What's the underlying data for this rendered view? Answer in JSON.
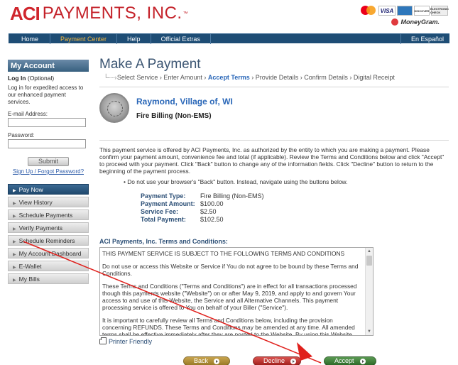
{
  "header": {
    "brand_aci": "ACI",
    "brand_rest": "PAYMENTS, INC.",
    "brand_tm": "™",
    "cards": {
      "visa": "VISA",
      "amex": "",
      "discover": "DISCOVER",
      "electronic": "ELECTRONIC CHECK"
    },
    "moneygram": "MoneyGram."
  },
  "nav": {
    "items": [
      "Home",
      "Payment Center",
      "Help",
      "Official Extras"
    ],
    "active": "Payment Center",
    "language": "En Español"
  },
  "sidebar": {
    "title": "My Account",
    "login_bold": "Log In",
    "login_optional": " (Optional)",
    "login_desc": "Log in for expedited access to our enhanced payment services.",
    "email_label": "E-mail Address:",
    "password_label": "Password:",
    "submit": "Submit",
    "signup": "Sign Up / Forgot Password?",
    "menu": [
      "Pay Now",
      "View History",
      "Schedule Payments",
      "Verify Payments",
      "Schedule Reminders",
      "My Account Dashboard",
      "E-Wallet",
      "My Bills"
    ]
  },
  "main": {
    "title": "Make A Payment",
    "steps_prefix": "Select Service › Enter Amount › ",
    "steps_current": "Accept Terms",
    "steps_suffix": " › Provide Details › Confirm Details › Digital Receipt",
    "biller_name": "Raymond, Village of, WI",
    "biller_service": "Fire Billing (Non-EMS)",
    "intro": "This payment service is offered by ACI Payments, Inc. as authorized by the entity to which you are making a payment. Please confirm your payment amount, convenience fee and total (if applicable). Review the Terms and Conditions below and click \"Accept\" to proceed with your payment. Click \"Back\" button to change any of the information fields. Click \"Decline\" button to return to the beginning of the payment process.",
    "bullet": "• Do not use your browser's \"Back\" button. Instead, navigate using the buttons below.",
    "payment": {
      "type_label": "Payment Type:",
      "type_value": "Fire Billing (Non-EMS)",
      "amount_label": "Payment Amount:",
      "amount_value": "$100.00",
      "fee_label": "Service Fee:",
      "fee_value": "$2.50",
      "total_label": "Total Payment:",
      "total_value": "$102.50"
    },
    "terms_title": "ACI Payments, Inc. Terms and Conditions:",
    "terms": [
      "THIS PAYMENT SERVICE IS SUBJECT TO THE FOLLOWING TERMS AND CONDITIONS",
      "Do not use or access this Website or Service if You do not agree to be bound by these Terms and Conditions.",
      "These Terms and Conditions (\"Terms and Conditions\") are in effect for all transactions processed though this payments website (\"Website\") on or after May 9, 2019, and apply to and govern Your access to and use of this Website, the Service and all Alternative Channels. This payment processing service is offered to You on behalf of your Biller (\"Service\").",
      "It is important to carefully review all Terms and Conditions below, including the provision concerning REFUNDS. These Terms and Conditions may be amended at any time. All amended terms shall be effective immediately after they are posted to the Website. By using this Website after such modifications are posted, You are agreeing to accept and comply with the Terms and Conditions as"
    ],
    "printer": "Printer Friendly",
    "buttons": {
      "back": "Back",
      "decline": "Decline",
      "accept": "Accept"
    }
  },
  "colors": {
    "brand_red": "#d0262d",
    "nav_blue": "#1e4d75",
    "link_blue": "#2a67b8",
    "annotation_red": "#e0201c"
  }
}
